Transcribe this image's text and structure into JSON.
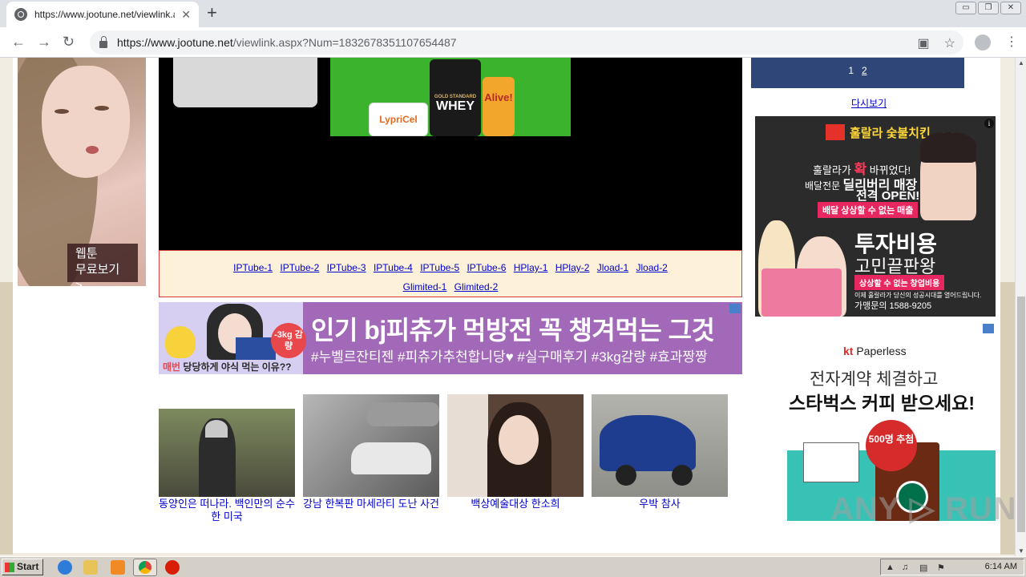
{
  "browser": {
    "tab_title": "https://www.jootune.net/viewlink.a",
    "tab_close": "✕",
    "new_tab": "+",
    "url_host": "https://www.jootune.net",
    "url_path": "/viewlink.aspx?Num=1832678351107654487",
    "window_controls": [
      "▭",
      "❐",
      "✕"
    ]
  },
  "left_ad": {
    "badge_line1": "웹툰",
    "badge_line2": "무료보기 >"
  },
  "player_ad": {
    "product1": "LypriCel",
    "product2": "WHEY",
    "product2_top": "GOLD STANDARD",
    "product3": "Alive!"
  },
  "links": {
    "row1": [
      "IPTube-1",
      "IPTube-2",
      "IPTube-3",
      "IPTube-4",
      "IPTube-5",
      "IPTube-6",
      "HPlay-1",
      "HPlay-2",
      "Jload-1",
      "Jload-2"
    ],
    "row2": [
      "Glimited-1",
      "Glimited-2"
    ]
  },
  "banner": {
    "headline": "인기 bj피츄가 먹방전 꼭 챙겨먹는 그것",
    "hashtags": "#누벨르잔티젠 #피츄가추천합니당♥ #실구매후기 #3kg감량 #효과짱짱",
    "tag": "-3kg 감량",
    "caption_red": "매번",
    "caption": " 당당하게 야식 먹는 이유??"
  },
  "thumbnails": [
    {
      "caption": "동양인은 떠나라. 백인만의 순수한 미국"
    },
    {
      "caption": "강남 한복판 마세라티 도난 사건"
    },
    {
      "caption": "백상예술대상 한소희"
    },
    {
      "caption": "우박 참사"
    }
  ],
  "pager": {
    "current": "1",
    "next": "2"
  },
  "view_again": "다시보기",
  "chicken_ad": {
    "brand": "훌랄라 숯불치킨",
    "line1_pre": "훌랄라가 ",
    "line1_em": "확",
    "line1_post": " 바뀌었다!",
    "line2_pre": "배달전문 ",
    "line2_em": "딜리버리 매장",
    "line3": "전격 OPEN!!",
    "pill1": "배달 상상할 수 없는 매출",
    "big1": "투자비용",
    "big2": "고민끝판왕",
    "pill2": "상상할 수 없는 창업비용",
    "small": "이제 훌랄라가 당신의 성공시대를 열어드립니다.",
    "phone": "가맹문의 1588-9205",
    "info": "i"
  },
  "kt_ad": {
    "logo_kt": "kt",
    "logo_rest": " Paperless",
    "line1": "전자계약 체결하고",
    "line2": "스타벅스 커피 받으세요!",
    "seal": "500명 추첨"
  },
  "watermark": "ANY ▷ RUN",
  "taskbar": {
    "start": "Start",
    "clock": "6:14 AM"
  }
}
